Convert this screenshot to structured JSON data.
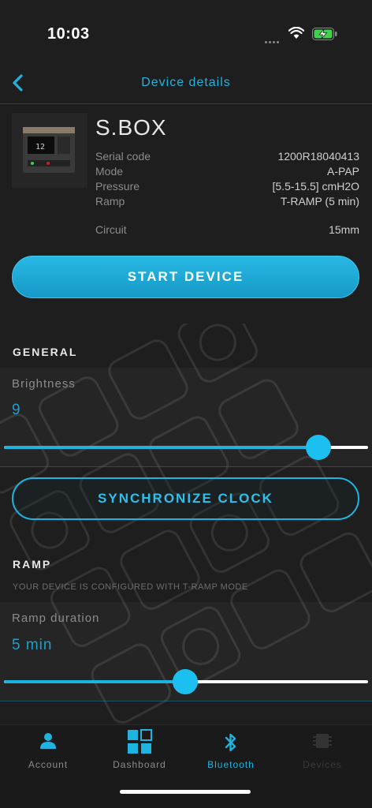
{
  "status_bar": {
    "time": "10:03"
  },
  "header": {
    "title": "Device details"
  },
  "device": {
    "name": "S.BOX",
    "specs": [
      {
        "key": "Serial code",
        "value": "1200R18040413"
      },
      {
        "key": "Mode",
        "value": "A-PAP"
      },
      {
        "key": "Pressure",
        "value": "[5.5-15.5] cmH2O"
      },
      {
        "key": "Ramp",
        "value": "T-RAMP (5 min)"
      },
      {
        "key": "Circuit",
        "value": "15mm"
      }
    ],
    "thumb_display": "12"
  },
  "actions": {
    "start_label": "START DEVICE",
    "sync_label": "SYNCHRONIZE CLOCK"
  },
  "general": {
    "title": "GENERAL",
    "brightness_label": "Brightness",
    "brightness_value": "9",
    "brightness_fraction": 0.863
  },
  "ramp": {
    "title": "RAMP",
    "note": "YOUR DEVICE IS CONFIGURED WITH T-RAMP MODE",
    "duration_label": "Ramp duration",
    "duration_value": "5 min",
    "duration_fraction": 0.497
  },
  "tabs": [
    {
      "label": "Account",
      "icon": "person-icon",
      "state": "normal"
    },
    {
      "label": "Dashboard",
      "icon": "grid-icon",
      "state": "normal"
    },
    {
      "label": "Bluetooth",
      "icon": "bluetooth-icon",
      "state": "active"
    },
    {
      "label": "Devices",
      "icon": "device-icon",
      "state": "disabled"
    }
  ],
  "colors": {
    "accent": "#1fb3e0",
    "background": "#1e1e1e",
    "text_muted": "#8c8c8c"
  }
}
